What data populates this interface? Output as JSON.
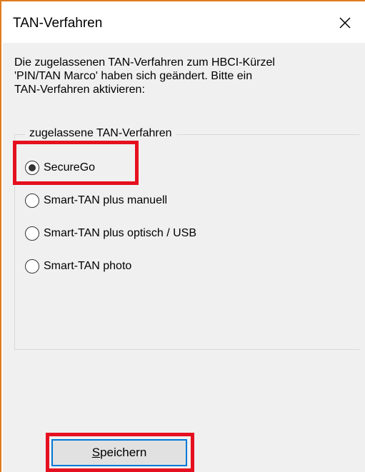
{
  "dialog": {
    "title": "TAN-Verfahren",
    "description": "Die zugelassenen TAN-Verfahren zum HBCI-Kürzel\n'PIN/TAN Marco' haben sich geändert. Bitte ein\nTAN-Verfahren aktivieren:"
  },
  "group": {
    "label": "zugelassene TAN-Verfahren",
    "options": [
      {
        "label": "SecureGo",
        "selected": true
      },
      {
        "label": "Smart-TAN plus manuell",
        "selected": false
      },
      {
        "label": "Smart-TAN plus optisch / USB",
        "selected": false
      },
      {
        "label": "Smart-TAN photo",
        "selected": false
      }
    ]
  },
  "buttons": {
    "save_first_letter": "S",
    "save_rest": "peichern"
  },
  "icons": {
    "close": "close-icon"
  },
  "colors": {
    "window_border": "#e07a1f",
    "highlight": "#e5101f",
    "focus_border": "#0078d7",
    "client_background": "#f0f0f0"
  }
}
